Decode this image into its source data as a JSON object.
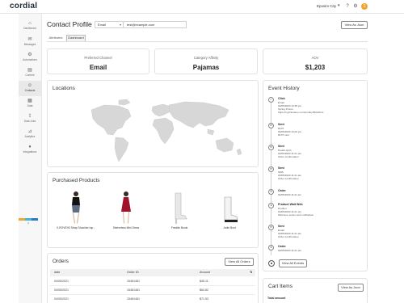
{
  "app": {
    "logo": "cordial",
    "account": "Eposim City"
  },
  "header_icons": [
    "help-icon",
    "settings-icon",
    "grid-icon",
    "bell-icon"
  ],
  "notifications_badge": "1",
  "sidebar": {
    "items": [
      {
        "key": "dashboard",
        "label": "Dashboard",
        "icon": "⌂"
      },
      {
        "key": "messages",
        "label": "Messages",
        "icon": "✉"
      },
      {
        "key": "automations",
        "label": "Automations",
        "icon": "⚙"
      },
      {
        "key": "content",
        "label": "Content",
        "icon": "▤"
      },
      {
        "key": "contacts",
        "label": "Contacts",
        "icon": "☺",
        "active": true
      },
      {
        "key": "data",
        "label": "Data",
        "icon": "▦"
      },
      {
        "key": "data-jobs",
        "label": "Data Jobs",
        "icon": "⇪"
      },
      {
        "key": "analytics",
        "label": "Analytics",
        "icon": "⊿"
      },
      {
        "key": "integrations",
        "label": "Integrations",
        "icon": "♦"
      }
    ],
    "brand_colors": [
      "#f0a52b",
      "#3db7d8",
      "#2a79c9"
    ]
  },
  "page": {
    "title": "Contact Profile"
  },
  "search": {
    "field": "Email",
    "value": "test@example.com"
  },
  "view_json_label": "View As Json",
  "tabs": [
    {
      "label": "Attributes",
      "active": false
    },
    {
      "label": "Dashboard",
      "active": true
    }
  ],
  "stats": [
    {
      "label": "Preferred Channel",
      "value": "Email"
    },
    {
      "label": "Category Affinity",
      "value": "Pajamas"
    },
    {
      "label": "AOV",
      "value": "$1,203"
    }
  ],
  "locations": {
    "title": "Locations"
  },
  "purchased_products": {
    "title": "Purchased Products",
    "items": [
      {
        "name": "X-ROVEH3 Strap Shoulder top..."
      },
      {
        "name": "Sleeveless Mini Dress"
      },
      {
        "name": "Freddie Boots"
      },
      {
        "name": "Jodie Boot"
      }
    ]
  },
  "orders": {
    "title": "Orders",
    "view_all_label": "View All Orders",
    "columns": [
      "date",
      "Order ID",
      "Amount"
    ],
    "rows": [
      {
        "date": "04/05/2021",
        "id": "15461461",
        "amount": "$45.11"
      },
      {
        "date": "04/05/2021",
        "id": "15461461",
        "amount": "$64.82"
      },
      {
        "date": "04/05/2021",
        "id": "15461461",
        "amount": "$71.53"
      }
    ]
  },
  "event_history": {
    "title": "Event History",
    "view_all_label": "View All Events",
    "events": [
      {
        "title": "Click",
        "icon": "✓",
        "lines": [
          "Email",
          "04/05/2020 12:35 pm",
          "Spring Promo",
          "https://mylinkname.com/product/5224/rss"
        ]
      },
      {
        "title": "Sent",
        "icon": "✉",
        "lines": [
          "ROIT",
          "04/05/2020 10:02 pm",
          "ROIT sent"
        ]
      },
      {
        "title": "Sent",
        "icon": "✉",
        "lines": [
          "Heads push",
          "04/05/2020 11:21 am",
          "Order confirmation"
        ]
      },
      {
        "title": "Sent",
        "icon": "✉",
        "lines": [
          "SMS",
          "04/05/2020 11:21 am",
          "Order confirmation"
        ]
      },
      {
        "title": "Order",
        "icon": "$",
        "lines": [
          "04/05/2020 11:21 am"
        ]
      },
      {
        "title": "Product Wait Web",
        "icon": "♦",
        "lines": [
          "Product",
          "04/05/2020 11:21 pm",
          "Welcome series web notification"
        ]
      },
      {
        "title": "Sent",
        "icon": "✉",
        "lines": [
          "Email",
          "04/05/2020 11:21 am",
          "Order confirmation"
        ]
      },
      {
        "title": "Order",
        "icon": "$",
        "lines": [
          "04/05/2020 11:21 am"
        ]
      }
    ]
  },
  "cart_items": {
    "title": "Cart Items",
    "view_json_label": "View As Json",
    "total_label": "Total amount"
  }
}
